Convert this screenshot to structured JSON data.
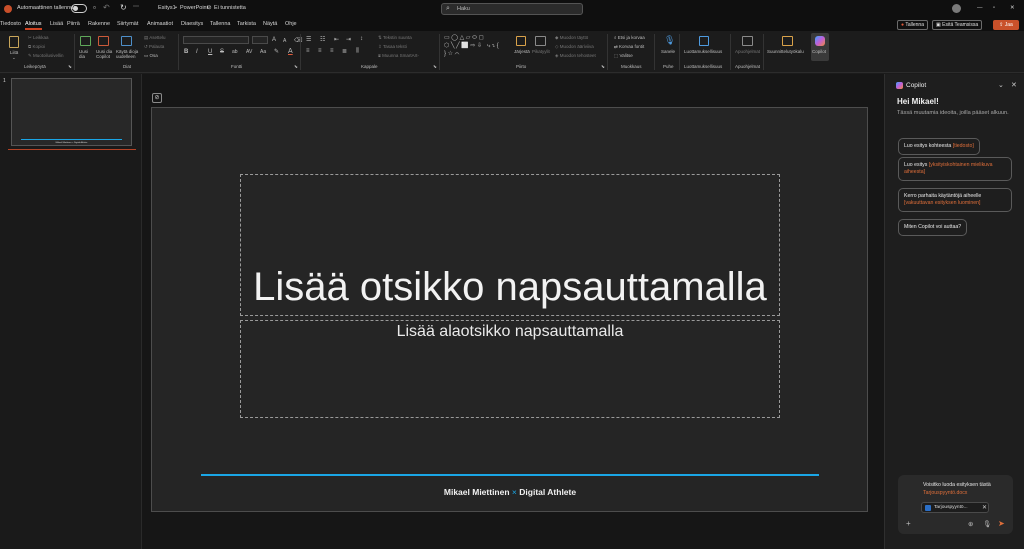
{
  "titlebar": {
    "autosave_label": "Automaattinen tallennus",
    "file_name": "Esitys1",
    "app_name": "PowerPoint",
    "label_status": "Ei tunnistetta",
    "search_placeholder": "Haku"
  },
  "menu": {
    "tabs": [
      "Tiedosto",
      "Aloitus",
      "Lisää",
      "Piirrä",
      "Rakenne",
      "Siirtymät",
      "Animaatiot",
      "Diaesitys",
      "Tallenna",
      "Tarkista",
      "Näytä",
      "Ohje"
    ],
    "active_tab": "Aloitus",
    "record_label": "Tallenna",
    "teams_label": "Esitä Teamsissa",
    "share_label": "Jaa"
  },
  "ribbon": {
    "clipboard": {
      "paste": "Liitä",
      "cut": "Leikkaa",
      "copy": "Kopioi",
      "format_painter": "Muotoilusivellin",
      "group": "Leikepöytä"
    },
    "slides": {
      "new_slide": "Uusi dia",
      "new_slide_copilot": "Uusi dia Copilot",
      "reuse_slides": "Käytä dioja uudelleen",
      "layout": "Asettelu",
      "reset": "Palauta",
      "section": "Osa",
      "group": "Diat"
    },
    "font": {
      "group": "Fontti",
      "buttons": [
        "B",
        "I",
        "U",
        "S",
        "ab",
        "AV",
        "Aa",
        "A",
        "A"
      ]
    },
    "paragraph": {
      "group": "Kappale",
      "text_direction": "Tekstin suunta",
      "align_text": "Tasaa teksti",
      "smartart": "Muunna SmartArt-"
    },
    "drawing": {
      "arrange": "Järjestä",
      "quick_styles": "Pikatyylit",
      "shape_fill": "Muodon täyttö",
      "shape_outline": "Muodon ääriviiva",
      "shape_effects": "Muodon tehosteet",
      "group": "Piirto"
    },
    "editing": {
      "find": "Etsi ja korvaa",
      "replace_fonts": "Korvaa fontit",
      "select": "Valitse",
      "group": "Muokkaus"
    },
    "voice": {
      "dictate": "Sanele",
      "group": "Puhe"
    },
    "sensitivity": {
      "label": "Luottamuksellisuus",
      "group": "Luottamuksellisuus"
    },
    "addins": {
      "label": "Apuohjelmat",
      "group": "Apuohjelmat"
    },
    "designer": {
      "label": "Suunnittelutyökalu"
    },
    "copilot": {
      "label": "Copilot"
    }
  },
  "thumbnails": [
    {
      "number": "1",
      "footer": "Mikael Miettinen × Digital Athlete"
    }
  ],
  "slide": {
    "title_placeholder": "Lisää otsikko napsauttamalla",
    "subtitle_placeholder": "Lisää alaotsikko napsauttamalla",
    "footer_left": "Mikael Miettinen",
    "footer_sep": "×",
    "footer_right": "Digital Athlete",
    "accent_line_color": "#1aa6e6"
  },
  "copilot_pane": {
    "title": "Copilot",
    "greeting": "Hei Mikael!",
    "intro": "Tässä muutamia ideoita, joilla pääset alkuun.",
    "suggestions": [
      {
        "text": "Luo esitys kohteesta",
        "placeholder": "[tiedosto]"
      },
      {
        "text": "Luo esitys",
        "placeholder": "[yksityiskohtainen mielikuva aiheesta]"
      },
      {
        "text": "Kerro parhaita käytäntöjä aiheelle",
        "placeholder": "[vakuuttavan esityksen luominen]"
      },
      {
        "text": "Miten Copilot voi auttaa?",
        "placeholder": ""
      }
    ],
    "input_prompt": "Voisitko luoda esityksen tästä",
    "input_reference": "Tarjouspyyntö.docx",
    "attachment_name": "Tarjouspyyntö...",
    "accent_color": "#e06f3a"
  }
}
